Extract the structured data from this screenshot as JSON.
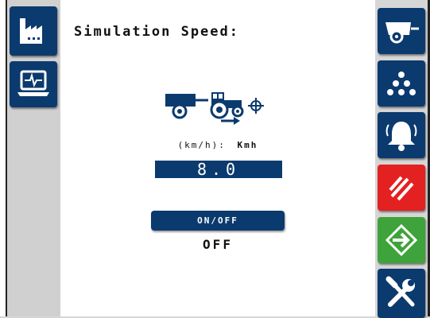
{
  "page": {
    "title": "Simulation Speed:",
    "unit_label": "(km/h):",
    "unit_value": "Kmh",
    "speed_value": "8.0",
    "toggle_button_label": "ON/OFF",
    "toggle_state": "OFF"
  },
  "left_sidebar": [
    {
      "name": "factory-icon"
    },
    {
      "name": "laptop-monitor-icon"
    }
  ],
  "right_sidebar": [
    {
      "name": "trailer-icon"
    },
    {
      "name": "seed-pattern-icon"
    },
    {
      "name": "alarm-bell-icon"
    },
    {
      "name": "stop-hatch-icon"
    },
    {
      "name": "exit-arrow-icon"
    },
    {
      "name": "tools-icon"
    }
  ],
  "colors": {
    "primary": "#0b3a6e",
    "alert": "#e32121",
    "accept": "#3ea33a",
    "rail": "#d0d0d0"
  }
}
